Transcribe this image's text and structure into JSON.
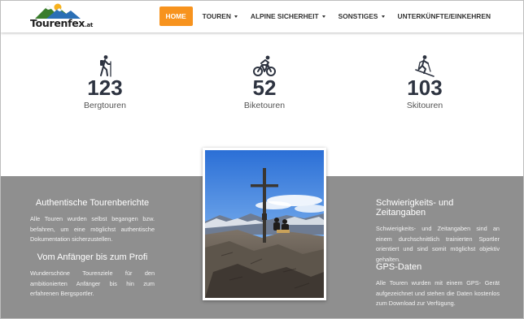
{
  "logo": {
    "text": "Tourenfex",
    "suffix": ".at"
  },
  "nav": {
    "items": [
      {
        "label": "HOME",
        "active": true,
        "dropdown": false
      },
      {
        "label": "TOUREN",
        "active": false,
        "dropdown": true
      },
      {
        "label": "ALPINE SICHERHEIT",
        "active": false,
        "dropdown": true
      },
      {
        "label": "SONSTIGES",
        "active": false,
        "dropdown": true
      },
      {
        "label": "UNTERKÜNFTE/EINKEHREN",
        "active": false,
        "dropdown": false
      }
    ],
    "active_color": "#f7931e"
  },
  "stats": [
    {
      "icon": "hiker-icon",
      "number": "123",
      "label": "Bergtouren"
    },
    {
      "icon": "mountain-bike-icon",
      "number": "52",
      "label": "Biketouren"
    },
    {
      "icon": "skier-icon",
      "number": "103",
      "label": "Skitouren"
    }
  ],
  "features": {
    "left": [
      {
        "title": "Authentische Tourenberichte",
        "text": "Alle Touren wurden selbst begangen bzw. befahren, um eine möglichst authentische Dokumentation sicherzustellen."
      },
      {
        "title": "Vom Anfänger bis zum Profi",
        "text": "Wunderschöne Tourenziele für den ambitionierten Anfänger bis hin zum erfahrenen Bergsportler."
      }
    ],
    "right": [
      {
        "title": "Schwierigkeits- und Zeitangaben",
        "text": "Schwierigkeits- und Zeitangaben sind an einem durchschnittlich trainierten Sportler orientiert und sind somit möglichst objektiv gehalten."
      },
      {
        "title": "GPS-Daten",
        "text": "Alle Touren wurden mit einem GPS- Gerät aufgezeichnet und stehen die Daten kostenlos zum Download zur Verfügung."
      }
    ]
  },
  "photo": {
    "icon": "summit-cross-photo"
  },
  "colors": {
    "band": "#8f8f8f",
    "stat_number": "#2d3340",
    "accent": "#f7931e"
  }
}
